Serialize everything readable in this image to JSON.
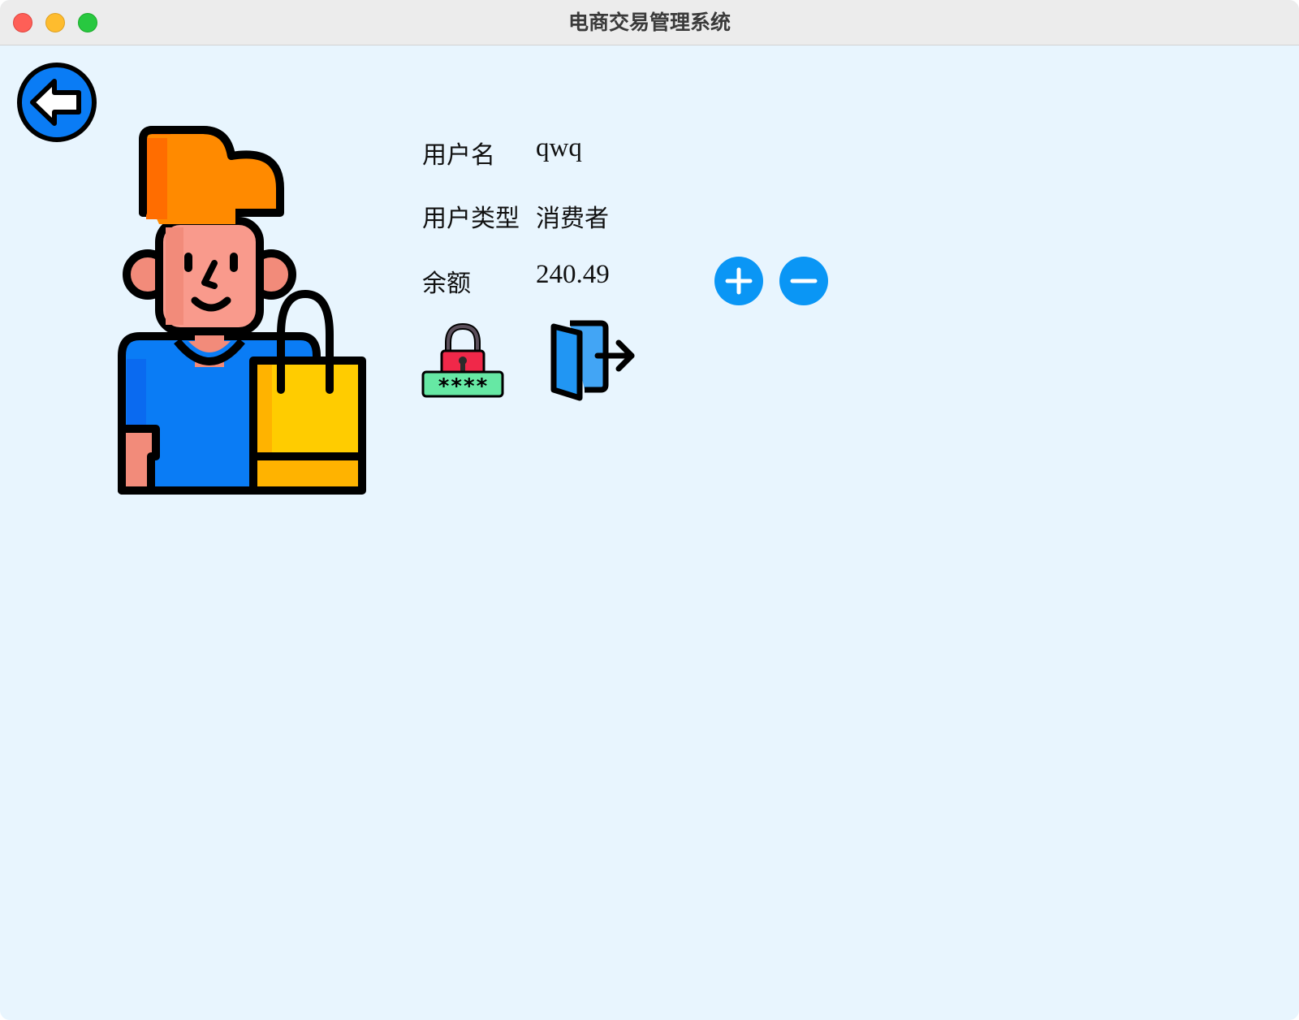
{
  "window": {
    "title": "电商交易管理系统"
  },
  "toolbar": {
    "back_icon": "arrow-left-circle-icon"
  },
  "profile": {
    "avatar_icon": "shopper-avatar-icon",
    "username_label": "用户名",
    "username_value": "qwq",
    "user_type_label": "用户类型",
    "user_type_value": "消费者",
    "balance_label": "余额",
    "balance_value": "240.49"
  },
  "actions": {
    "add_balance_icon": "plus-circle-icon",
    "subtract_balance_icon": "minus-circle-icon",
    "change_password_icon": "lock-password-icon",
    "logout_icon": "door-exit-icon"
  },
  "colors": {
    "background": "#e8f5fe",
    "accent_blue": "#0a96f5",
    "back_button_blue": "#0a7cf5"
  }
}
